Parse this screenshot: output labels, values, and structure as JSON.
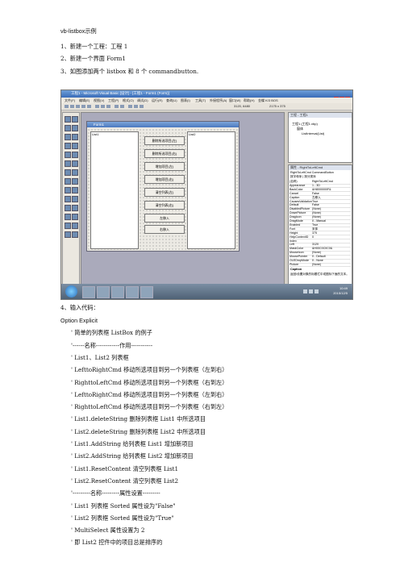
{
  "doc": {
    "title": "vb-listbox示例",
    "steps": [
      "1、新建一个工程：工程 1",
      "2、新建一个界面 Form1",
      "3、如图添加两个 listbox 和 8 个  commandbutton.",
      "4、输入代码："
    ],
    "code": [
      "Option Explicit",
      "' 简单的列表框 ListBox 的例子",
      "'------名称------------作用-----------",
      "' List1、List2  列表框",
      "' LefttoRightCmd  移动所选项目到另一个列表框（左到右）",
      "' RighttoLeftCmd  移动所选项目到另一个列表框（右到左）",
      "' LefttoRightCmd  移动所选项目到另一个列表框（左到右）",
      "' RighttoLeftCmd  移动所选项目到另一个列表框（右到左）",
      "' List1.deleteString  删除列表框 List1 中所选项目",
      "' List2.deleteString  删除列表框 List2 中所选项目",
      "' List1.AddString  给列表框 List1 增加新项目",
      "' List2.AddString 给列表框 List2 增加新项目",
      "' List1.ResetContent 清空列表框 List1",
      "' List2.ResetContent  清空列表框 List2",
      "'---------名称---------属性设置---------",
      "' List1 列表框  Sorted 属性设为\"False\"",
      "' List2 列表框  Sorted 属性设为\"True\"",
      "' MultiSelect 属性设置为 2",
      "'  即 List2 控件中的项目总是排序的"
    ]
  },
  "screenshot": {
    "window_title": "工程1 - Microsoft Visual Basic [设计] - [工程1 - Form1 (Form)]",
    "menu": [
      "文件(F)",
      "编辑(E)",
      "视图(V)",
      "工程(P)",
      "格式(O)",
      "调试(D)",
      "运行(R)",
      "查询(U)",
      "图表(I)",
      "工具(T)",
      "外接程序(A)",
      "窗口(W)",
      "帮助(H)",
      "金蝶 K/3 BOS"
    ],
    "toolbar_coords": "3120, 6480",
    "toolbar_size": "2175 x 375",
    "form_title": "Form1",
    "list1_label": "List1",
    "list2_label": "List2",
    "buttons": [
      "删除所选项目(左)",
      "删除所选项目(右)",
      "增加项目(左)",
      "增加项目(右)",
      "清空列表(左)",
      "清空列表(右)",
      "左移入",
      "右移入"
    ],
    "project_title": "工程 - 工程1",
    "project_tree": [
      "工程1 (工程1.vbp)",
      "窗体",
      "ListInterval(List)"
    ],
    "props_title": "属性 - RightToLeftCmd",
    "props_object": "RightToLeftCmd CommandButton",
    "props_tabs": "按字母序 | 按分类序",
    "props": [
      [
        "(名称)",
        "RightToLeftCmd"
      ],
      [
        "Appearance",
        "1 - 3D"
      ],
      [
        "BackColor",
        "&H8000000F&"
      ],
      [
        "Cancel",
        "False"
      ],
      [
        "Caption",
        "左移入"
      ],
      [
        "CausesValidation",
        "True"
      ],
      [
        "Default",
        "False"
      ],
      [
        "DisabledPicture",
        "(None)"
      ],
      [
        "DownPicture",
        "(None)"
      ],
      [
        "DragIcon",
        "(None)"
      ],
      [
        "DragMode",
        "0 - Manual"
      ],
      [
        "Enabled",
        "True"
      ],
      [
        "Font",
        "宋体"
      ],
      [
        "Height",
        "375"
      ],
      [
        "HelpContextID",
        "0"
      ],
      [
        "Index",
        ""
      ],
      [
        "Left",
        "3120"
      ],
      [
        "MaskColor",
        "&H00C0C0C0&"
      ],
      [
        "MouseIcon",
        "(None)"
      ],
      [
        "MousePointer",
        "0 - Default"
      ],
      [
        "OLEDropMode",
        "0 - None"
      ],
      [
        "Picture",
        "(None)"
      ]
    ],
    "props_desc_title": "Caption",
    "props_desc": "返回/设置对象的标题栏中或图标下面的文本。",
    "clock_time": "10:49",
    "clock_date": "2015/12/5"
  }
}
